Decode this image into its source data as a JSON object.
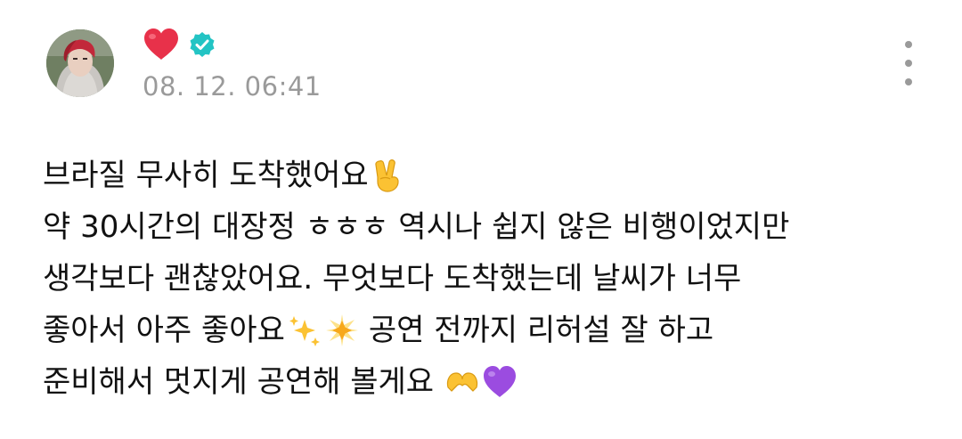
{
  "header": {
    "timestamp": "08. 12. 06:41",
    "heart_icon": "red-heart-icon",
    "verified_icon": "verified-badge-icon"
  },
  "post": {
    "line1": "브라질 무사히 도착했어요",
    "line2": "약 30시간의 대장정 ㅎㅎㅎ 역시나 쉽지 않은 비행이었지만",
    "line3": "생각보다 괜찮았어요. 무엇보다 도착했는데 날씨가 너무",
    "line4a": "좋아서 아주 좋아요",
    "line4b": "공연 전까지 리허설 잘 하고",
    "line5": "준비해서 멋지게 공연해 볼게요",
    "emojis": {
      "line1": "victory-hand",
      "line4": [
        "sparkles",
        "glowing-star"
      ],
      "line5": [
        "heart-hands",
        "purple-heart"
      ]
    }
  },
  "colors": {
    "heart": "#e8314a",
    "verified": "#23c4c4",
    "timestamp": "#9a9a9a",
    "text": "#111111",
    "purple_heart": "#9b4ce0",
    "emoji_yellow": "#fbc233"
  }
}
